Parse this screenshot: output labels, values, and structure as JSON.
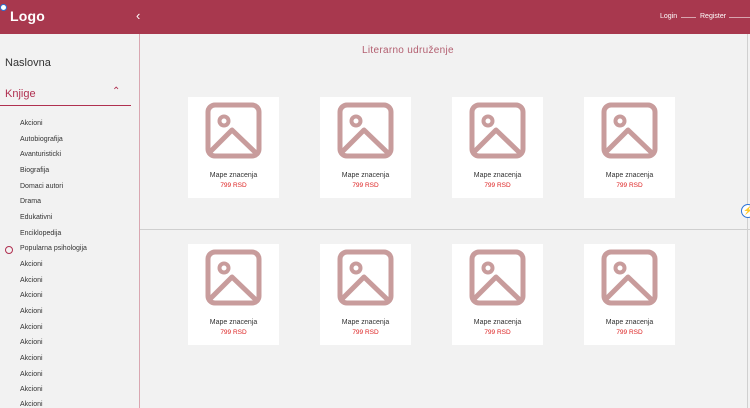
{
  "header": {
    "logo": "Logo",
    "collapse_icon": "chevron-left-icon",
    "login": "Login",
    "register": "Register",
    "bg_color": "#a8384e"
  },
  "sidebar": {
    "home": "Naslovna",
    "books": "Knjige",
    "books_chevron": "chevron-up-icon",
    "accent_color": "#b03050",
    "subitems": [
      "Akcioni",
      "Autobiografija",
      "Avanturisticki",
      "Biografija",
      "Domaci autori",
      "Drama",
      "Edukativni",
      "Enciklopedija",
      "Popularna psihologija",
      "Akcioni",
      "Akcioni",
      "Akcioni",
      "Akcioni",
      "Akcioni",
      "Akcioni",
      "Akcioni",
      "Akcioni",
      "Akcioni",
      "Akcioni"
    ]
  },
  "main": {
    "title": "Literarno udruženje",
    "cards": [
      {
        "title": "Mape znacenja",
        "price": "799 RSD"
      },
      {
        "title": "Mape znacenja",
        "price": "799 RSD"
      },
      {
        "title": "Mape znacenja",
        "price": "799 RSD"
      },
      {
        "title": "Mape znacenja",
        "price": "799 RSD"
      },
      {
        "title": "Mape znacenja",
        "price": "799 RSD"
      },
      {
        "title": "Mape znacenja",
        "price": "799 RSD"
      },
      {
        "title": "Mape znacenja",
        "price": "799 RSD"
      },
      {
        "title": "Mape znacenja",
        "price": "799 RSD"
      }
    ],
    "placeholder_color": "#c89c9c",
    "price_color": "#dd2222"
  }
}
